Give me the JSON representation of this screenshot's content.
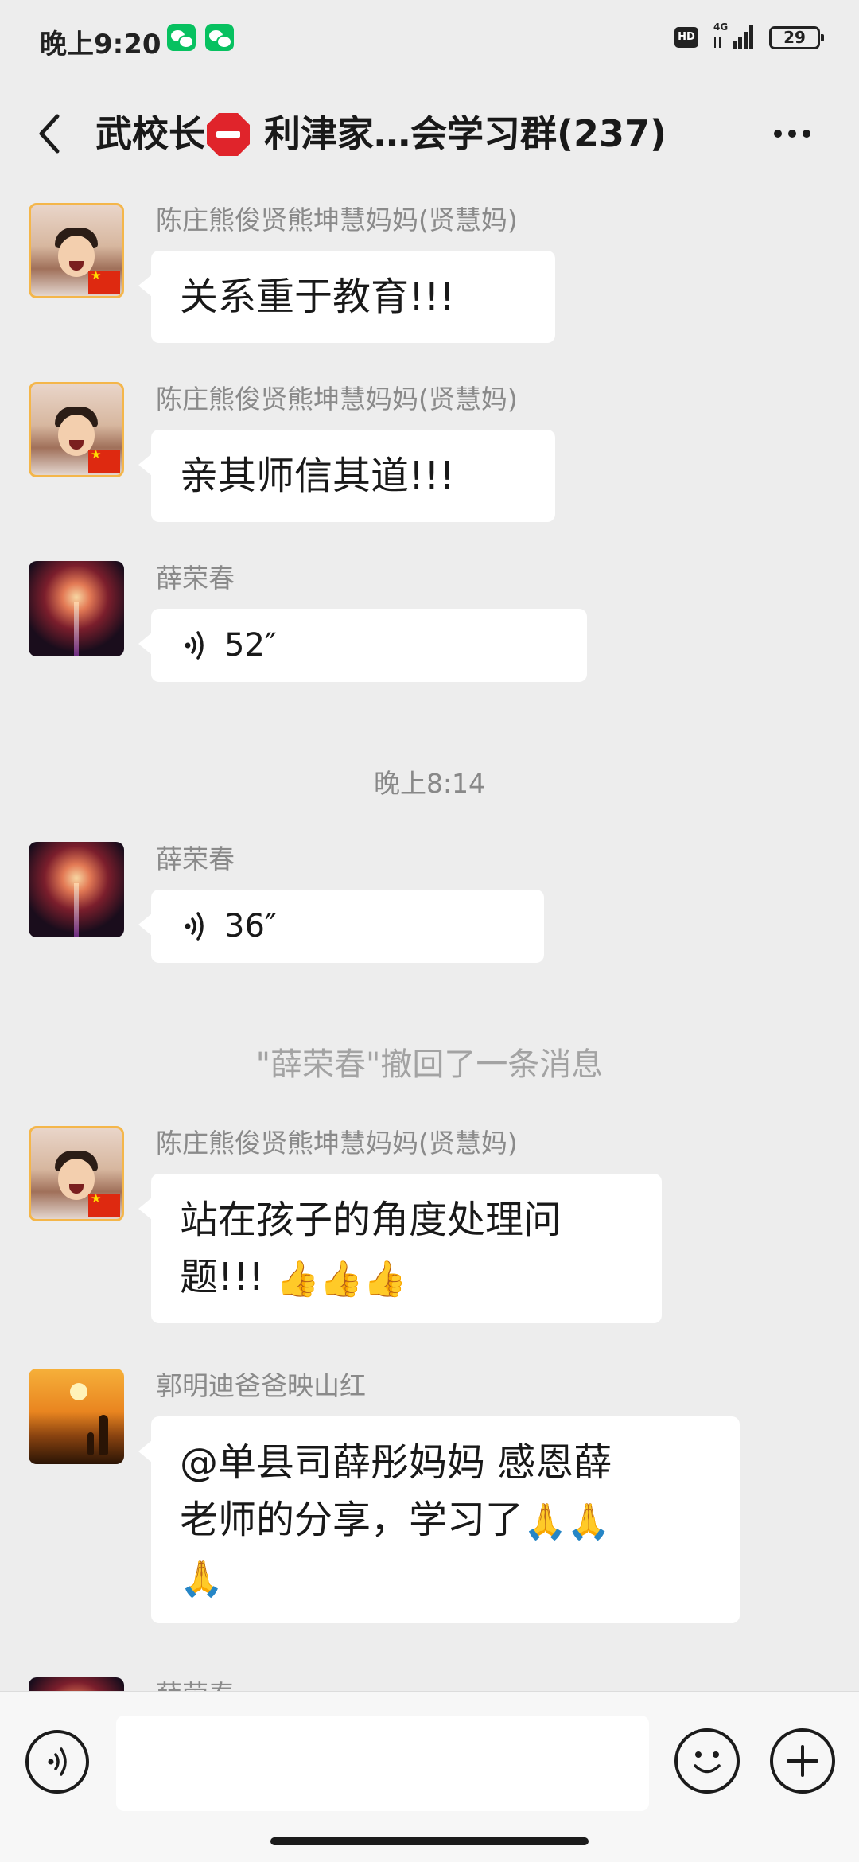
{
  "status_bar": {
    "time": "晚上9:20",
    "network": "4G",
    "battery": "29",
    "hd": "HD"
  },
  "header": {
    "title_prefix": "武校长",
    "title_suffix": " 利津家…会学习群(237)",
    "title_icon": "stop-sign-icon"
  },
  "messages": [
    {
      "sender": "陈庄熊俊贤熊坤慧妈妈(贤慧妈)",
      "text": "关系重于教育!!!",
      "avatar": "kid-with-flag"
    },
    {
      "sender": "陈庄熊俊贤熊坤慧妈妈(贤慧妈)",
      "text": "亲其师信其道!!!",
      "avatar": "kid-with-flag"
    },
    {
      "sender": "薛荣春",
      "voice_duration": "52″",
      "avatar": "fireworks"
    },
    {
      "sender": "薛荣春",
      "voice_duration": "36″",
      "avatar": "fireworks"
    },
    {
      "sender": "陈庄熊俊贤熊坤慧妈妈(贤慧妈)",
      "text_line1": "站在孩子的角度处理问",
      "text_line2": "题!!! ",
      "emojis": "👍👍👍",
      "avatar": "kid-with-flag"
    },
    {
      "sender": "郭明迪爸爸映山红",
      "text_line1": "@单县司薛彤妈妈  感恩薛",
      "text_line2": "老师的分享，学习了",
      "emojis_line2": "🙏🙏",
      "emojis_line3": "🙏",
      "avatar": "sunset"
    },
    {
      "sender": "薛荣春",
      "avatar": "fireworks"
    }
  ],
  "time_divider": "晚上8:14",
  "recall_notice": "\"薛荣春\"撤回了一条消息",
  "input_bar": {
    "placeholder": ""
  },
  "colors": {
    "background": "#ededed",
    "bubble": "#ffffff",
    "sender_name": "#8a8a8a",
    "wechat_green": "#07c160"
  }
}
